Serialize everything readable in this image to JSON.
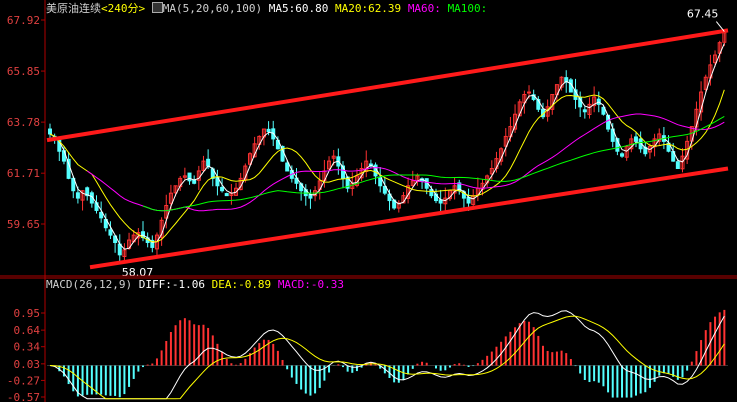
{
  "header": {
    "instrument": "美原油连续",
    "period": "<240分>",
    "ma_params": "MA(5,20,60,100)",
    "ma5": "MA5:60.80",
    "ma20": "MA20:62.39",
    "ma60": "MA60:",
    "ma100": "MA100:"
  },
  "macd_header": {
    "params": "MACD(26,12,9)",
    "diff": "DIFF:-1.06",
    "dea": "DEA:-0.89",
    "macd": "MACD:-0.33"
  },
  "colors": {
    "up": "#ff3232",
    "down": "#54ffff",
    "ma5": "#ffffff",
    "ma20": "#ffff00",
    "ma60": "#ff00ff",
    "ma100": "#00ff00",
    "channel": "#ff1a1a",
    "axis": "#b00000",
    "text": "#d0d0d0"
  },
  "chart_data": [
    {
      "type": "candlestick",
      "y_ticks": [
        "67.92",
        "65.85",
        "63.78",
        "61.71",
        "59.65"
      ],
      "ylim": [
        57.6,
        68.05
      ],
      "high_label": "67.45",
      "low_label": "58.07",
      "close_series": [
        63.3,
        63.1,
        62.6,
        62.2,
        61.5,
        61.0,
        60.7,
        61.0,
        60.8,
        60.5,
        60.2,
        59.9,
        59.5,
        59.2,
        58.9,
        58.4,
        58.6,
        59.0,
        59.2,
        59.3,
        59.1,
        58.9,
        58.7,
        59.2,
        59.8,
        60.4,
        60.9,
        61.2,
        61.5,
        61.6,
        61.4,
        61.3,
        61.8,
        62.2,
        62.0,
        61.5,
        61.2,
        61.0,
        60.8,
        60.9,
        61.1,
        61.5,
        62.0,
        62.5,
        62.9,
        63.2,
        63.5,
        63.4,
        63.1,
        62.7,
        62.2,
        61.8,
        61.5,
        61.3,
        61.0,
        60.8,
        60.7,
        61.0,
        61.4,
        61.8,
        62.2,
        62.4,
        62.0,
        61.5,
        61.1,
        61.3,
        61.6,
        61.9,
        62.2,
        62.0,
        61.6,
        61.2,
        60.9,
        60.6,
        60.3,
        60.5,
        60.8,
        61.2,
        61.4,
        61.6,
        61.4,
        61.1,
        60.8,
        60.6,
        60.5,
        60.7,
        61.0,
        61.2,
        61.0,
        60.7,
        60.5,
        60.8,
        61.1,
        61.3,
        61.6,
        61.9,
        62.3,
        62.7,
        63.2,
        63.6,
        64.1,
        64.6,
        64.9,
        65.0,
        64.7,
        64.3,
        64.0,
        64.4,
        64.9,
        65.3,
        65.6,
        65.4,
        65.0,
        64.7,
        64.4,
        64.2,
        64.5,
        64.8,
        64.5,
        64.1,
        63.5,
        63.0,
        62.6,
        62.4,
        62.8,
        63.1,
        63.0,
        62.7,
        62.5,
        62.8,
        63.1,
        63.3,
        63.0,
        62.6,
        62.2,
        61.9,
        62.4,
        63.0,
        63.6,
        64.3,
        65.0,
        65.6,
        66.1,
        66.5,
        67.0,
        67.4
      ],
      "channel_upper": [
        [
          63.05,
          67.5
        ]
      ],
      "channel_lower": [
        [
          58.06,
          61.9
        ]
      ]
    },
    {
      "type": "macd",
      "y_ticks": [
        "0.95",
        "0.64",
        "0.34",
        "0.03",
        "-0.27",
        "-0.57"
      ],
      "ylim": [
        -0.6,
        1.15
      ],
      "series": [
        {
          "name": "DIFF"
        },
        {
          "name": "DEA"
        },
        {
          "name": "MACD"
        }
      ]
    }
  ]
}
